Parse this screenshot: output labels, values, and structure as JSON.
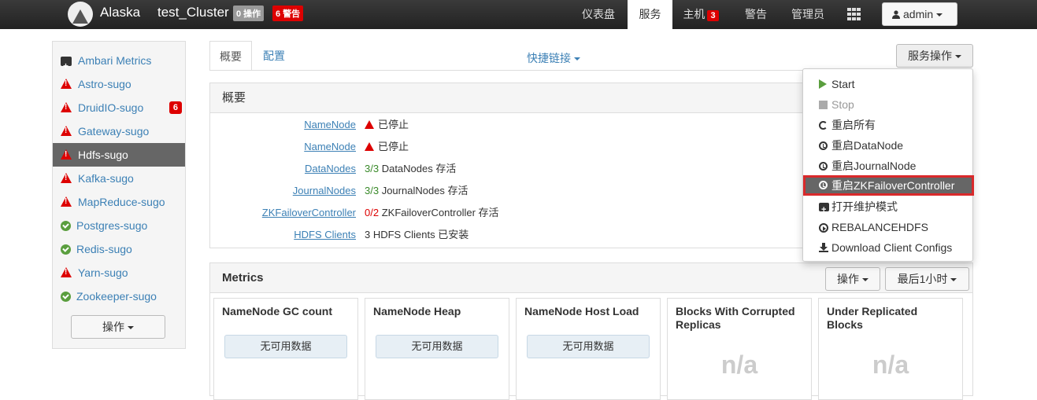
{
  "topbar": {
    "brand": "Alaska",
    "cluster": "test_Cluster",
    "ops_badge": "0 操作",
    "alerts_badge": "6 警告",
    "nav": [
      {
        "label": "仪表盘"
      },
      {
        "label": "服务"
      },
      {
        "label": "主机",
        "count": "3"
      },
      {
        "label": "警告"
      },
      {
        "label": "管理员"
      }
    ],
    "user": "admin"
  },
  "sidebar": {
    "items": [
      {
        "label": "Ambari Metrics",
        "status": "maintenance"
      },
      {
        "label": "Astro-sugo",
        "status": "warning"
      },
      {
        "label": "DruidIO-sugo",
        "status": "warning",
        "count": "6"
      },
      {
        "label": "Gateway-sugo",
        "status": "warning"
      },
      {
        "label": "Hdfs-sugo",
        "status": "warning",
        "active": true
      },
      {
        "label": "Kafka-sugo",
        "status": "warning"
      },
      {
        "label": "MapReduce-sugo",
        "status": "warning"
      },
      {
        "label": "Postgres-sugo",
        "status": "ok"
      },
      {
        "label": "Redis-sugo",
        "status": "ok"
      },
      {
        "label": "Yarn-sugo",
        "status": "warning"
      },
      {
        "label": "Zookeeper-sugo",
        "status": "ok"
      }
    ],
    "actions_label": "操作"
  },
  "tabs": {
    "summary": "概要",
    "configs": "配置",
    "quick_links": "快捷链接",
    "service_actions": "服务操作"
  },
  "summary": {
    "title": "概要",
    "rows": [
      {
        "label": "NameNode",
        "value": "已停止",
        "alert": true
      },
      {
        "label": "NameNode",
        "value": "已停止",
        "alert": true
      },
      {
        "label": "DataNodes",
        "count": "3/3",
        "value": "DataNodes 存活",
        "count_color": "green"
      },
      {
        "label": "JournalNodes",
        "count": "3/3",
        "value": "JournalNodes 存活",
        "count_color": "green"
      },
      {
        "label": "ZKFailoverController",
        "count": "0/2",
        "value": "ZKFailoverController 存活",
        "count_color": "red"
      },
      {
        "label": "HDFS Clients",
        "value": "3 HDFS Clients 已安装"
      }
    ]
  },
  "metrics": {
    "title": "Metrics",
    "actions_label": "操作",
    "range_label": "最后1小时",
    "cards": [
      {
        "title": "NameNode GC count",
        "content": "无可用数据"
      },
      {
        "title": "NameNode Heap",
        "content": "无可用数据"
      },
      {
        "title": "NameNode Host Load",
        "content": "无可用数据"
      },
      {
        "title": "Blocks With Corrupted Replicas",
        "content": "n/a"
      },
      {
        "title": "Under Replicated Blocks",
        "content": "n/a"
      }
    ]
  },
  "dropdown": {
    "items": [
      {
        "label": "Start",
        "icon": "play-icon"
      },
      {
        "label": "Stop",
        "icon": "stop-icon",
        "disabled": true
      },
      {
        "label": "重启所有",
        "icon": "refresh-icon"
      },
      {
        "label": "重启DataNode",
        "icon": "clock-icon"
      },
      {
        "label": "重启JournalNode",
        "icon": "clock-icon"
      },
      {
        "label": "重启ZKFailoverController",
        "icon": "clock-icon",
        "highlighted": true
      },
      {
        "label": "打开维护模式",
        "icon": "maintenance-icon"
      },
      {
        "label": "REBALANCEHDFS",
        "icon": "circle-play-icon"
      },
      {
        "label": "Download Client Configs",
        "icon": "download-icon"
      }
    ]
  },
  "colors": {
    "accent_link": "#3c80b5",
    "alert_red": "#d00",
    "ok_green": "#5a9e3e",
    "highlight_border": "#d9292b"
  }
}
